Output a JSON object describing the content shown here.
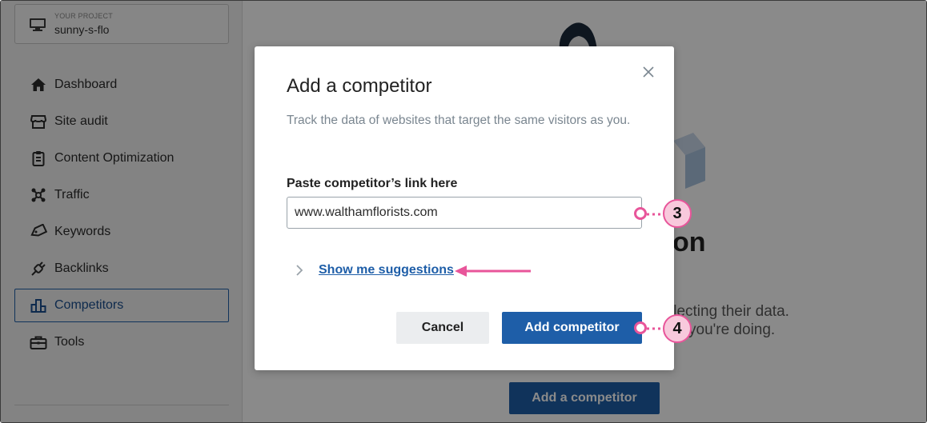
{
  "project": {
    "label": "YOUR PROJECT",
    "name": "sunny-s-flo"
  },
  "sidebar": {
    "items": [
      {
        "label": "Dashboard",
        "icon": "home-icon"
      },
      {
        "label": "Site audit",
        "icon": "store-icon"
      },
      {
        "label": "Content Optimization",
        "icon": "clipboard-icon"
      },
      {
        "label": "Traffic",
        "icon": "network-icon"
      },
      {
        "label": "Keywords",
        "icon": "tags-icon"
      },
      {
        "label": "Backlinks",
        "icon": "plug-icon"
      },
      {
        "label": "Competitors",
        "icon": "podium-icon",
        "active": true
      },
      {
        "label": "Tools",
        "icon": "toolbox-icon"
      }
    ]
  },
  "background": {
    "heading_fragment": "on",
    "text_line1": "llecting their data.",
    "text_line2": "you're doing.",
    "button": "Add a competitor"
  },
  "modal": {
    "title": "Add a competitor",
    "description": "Track the data of websites that target the same visitors as you.",
    "field_label": "Paste competitor’s link here",
    "field_value": "www.walthamflorists.com",
    "suggestions_link": "Show me suggestions",
    "cancel_label": "Cancel",
    "submit_label": "Add competitor"
  },
  "annotations": {
    "step_input": "3",
    "step_submit": "4"
  },
  "colors": {
    "accent": "#1e5ea8",
    "annotation_pink": "#e8559a",
    "badge_fill": "#f8c9dc"
  }
}
